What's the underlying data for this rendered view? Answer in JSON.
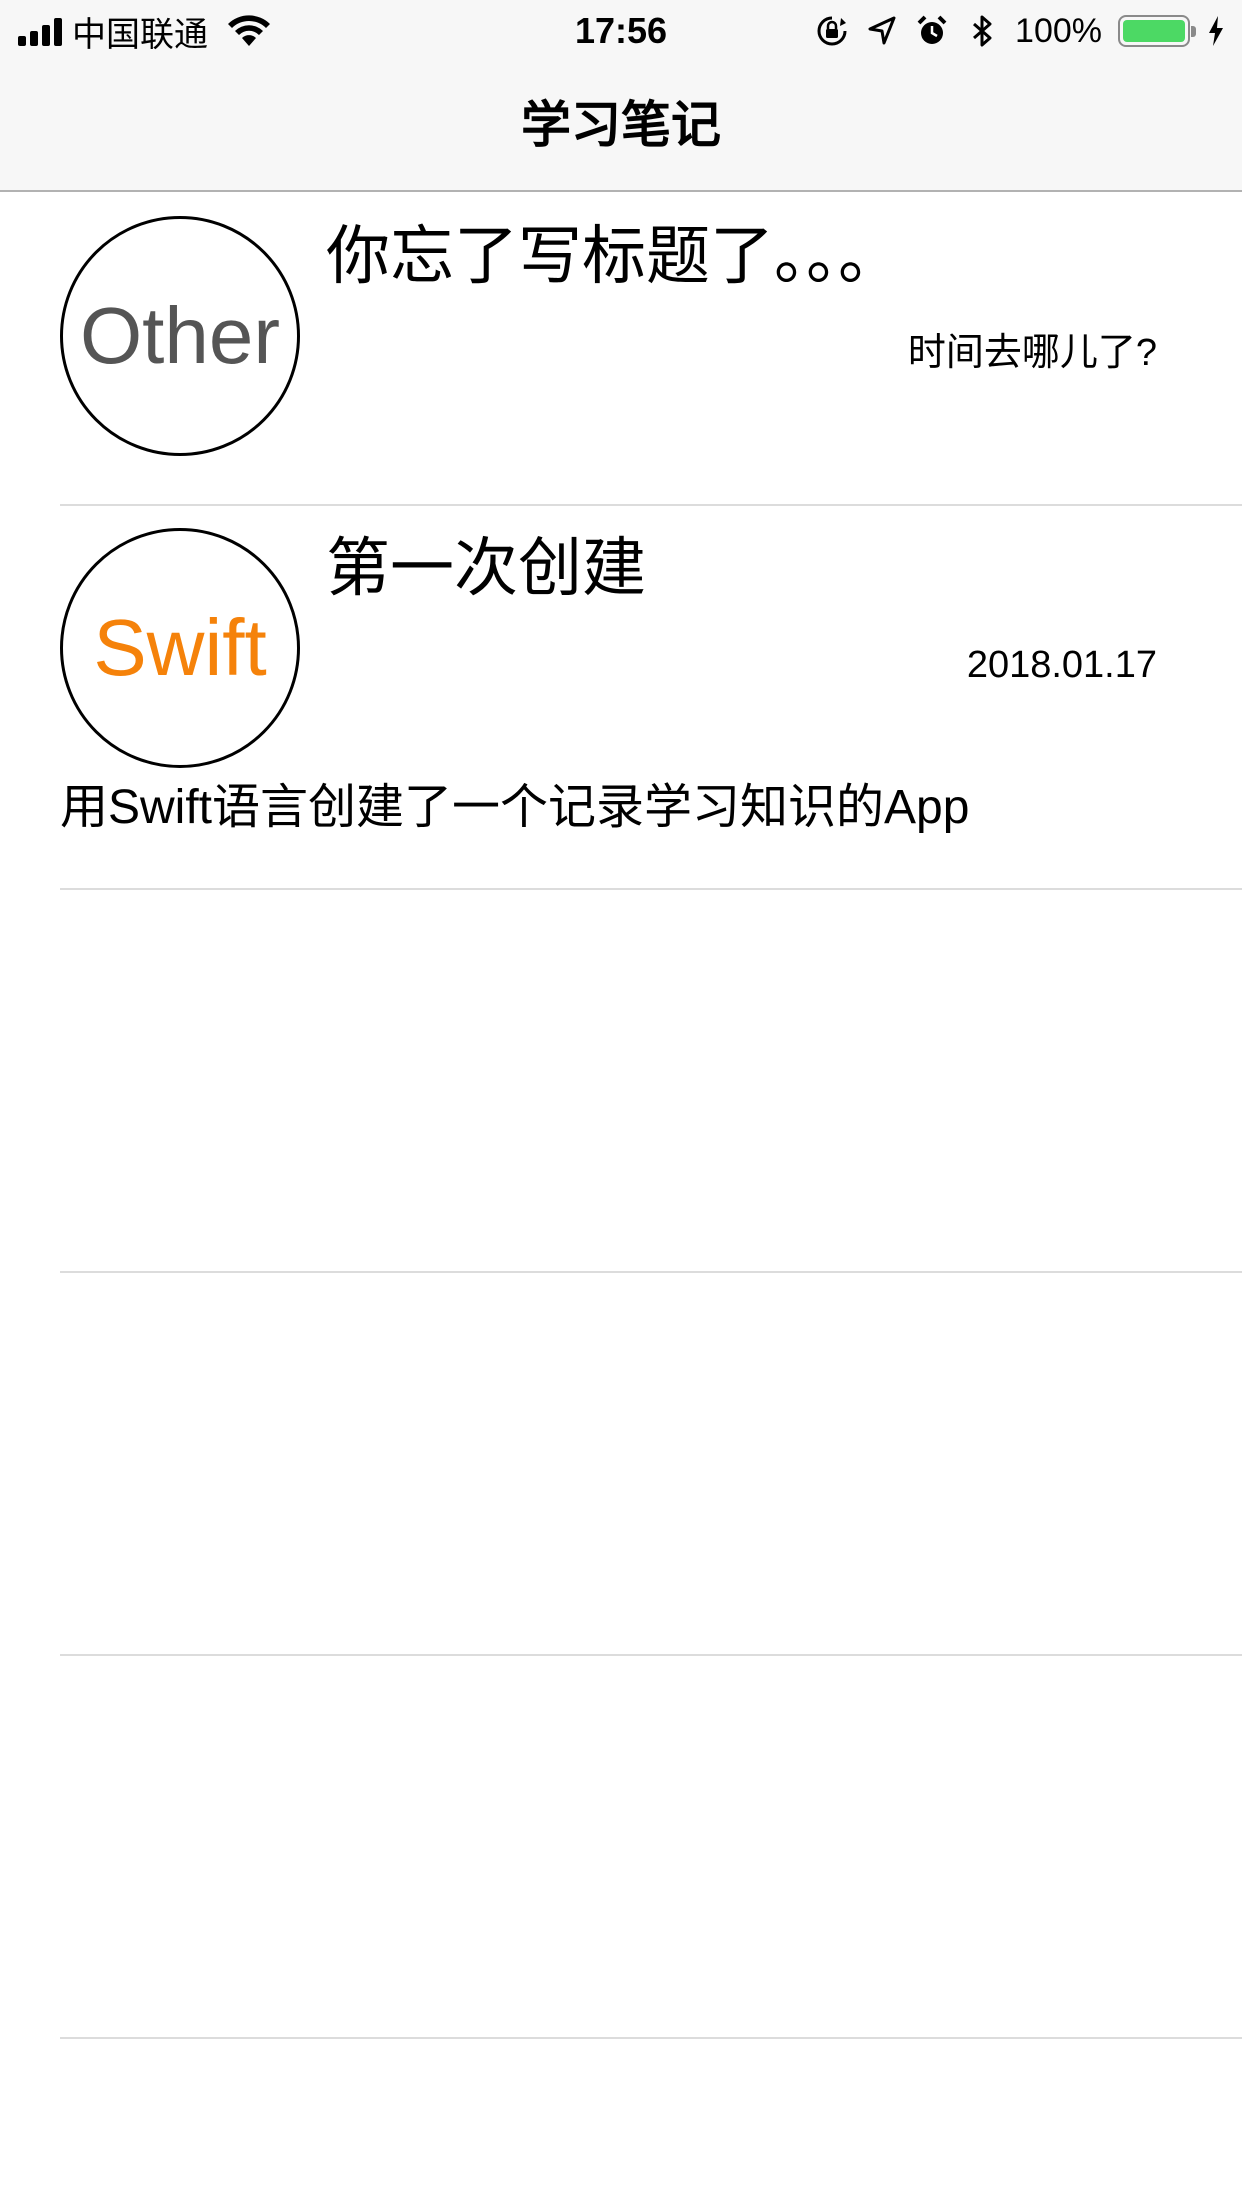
{
  "status_bar": {
    "carrier": "中国联通",
    "time": "17:56",
    "battery_percent": "100%",
    "battery_level": 1.0,
    "battery_color": "#4cd964",
    "icons": [
      "signal-icon",
      "wifi-icon",
      "orientation-lock-icon",
      "location-icon",
      "alarm-icon",
      "bluetooth-icon",
      "battery-icon",
      "charging-icon"
    ]
  },
  "nav": {
    "title": "学习笔记"
  },
  "notes": [
    {
      "avatar_label": "Other",
      "avatar_color": "#555555",
      "title": "你忘了写标题了。。。",
      "date": "时间去哪儿了?",
      "description": ""
    },
    {
      "avatar_label": "Swift",
      "avatar_color": "#f5820a",
      "title": "第一次创建",
      "date": "2018.01.17",
      "description": "用Swift语言创建了一个记录学习知识的App"
    }
  ]
}
